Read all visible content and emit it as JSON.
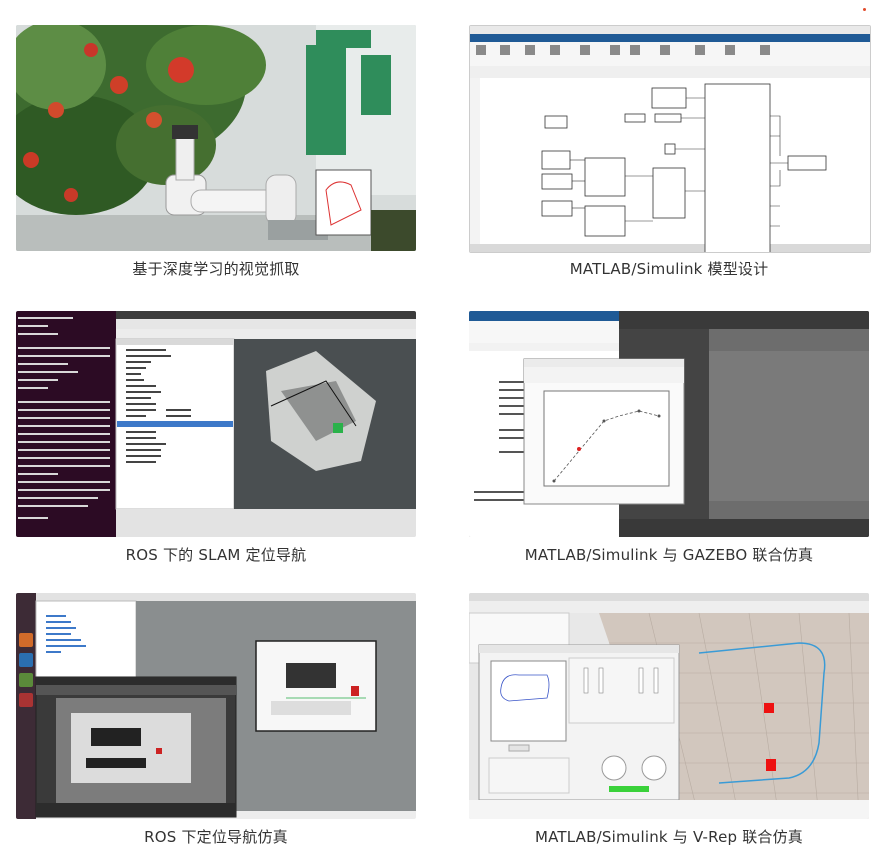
{
  "accent_dot_color": "#e24a2a",
  "cards": [
    {
      "caption": "基于深度学习的视觉抓取",
      "icon": "robot-arm-grasping-apples-photo"
    },
    {
      "caption": "MATLAB/Simulink 模型设计",
      "icon": "simulink-model-window"
    },
    {
      "caption": "ROS 下的 SLAM 定位导航",
      "icon": "ros-rviz-slam-window"
    },
    {
      "caption": "MATLAB/Simulink 与 GAZEBO 联合仿真",
      "icon": "matlab-gazebo-window"
    },
    {
      "caption": "ROS 下定位导航仿真",
      "icon": "ros-navigation-sim-window"
    },
    {
      "caption": "MATLAB/Simulink 与 V-Rep 联合仿真",
      "icon": "matlab-vrep-window"
    }
  ]
}
